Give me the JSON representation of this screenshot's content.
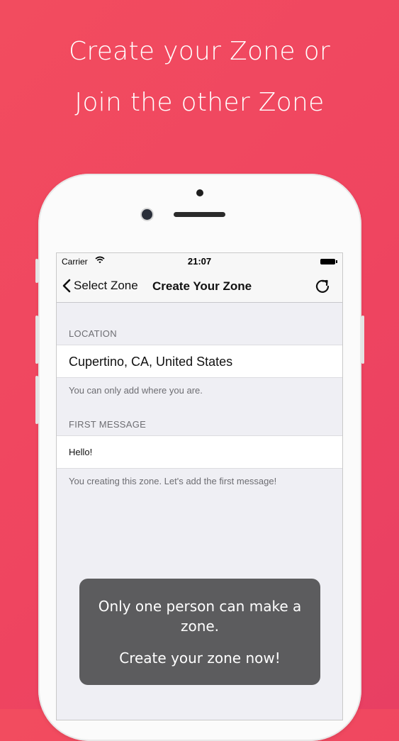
{
  "promo": {
    "line1": "Create your Zone or",
    "line2": "Join the other Zone"
  },
  "status_bar": {
    "carrier": "Carrier",
    "time": "21:07"
  },
  "nav": {
    "back_label": "Select Zone",
    "title": "Create Your Zone"
  },
  "location": {
    "header": "LOCATION",
    "value": "Cupertino, CA, United States",
    "footer": "You can only add where you are."
  },
  "first_message": {
    "header": "FIRST MESSAGE",
    "value": "Hello!",
    "footer": "You creating this zone. Let's add the first message!"
  },
  "toast": {
    "line1": "Only one person can make a zone.",
    "line2": "Create your zone now!"
  },
  "colors": {
    "background": "#ef4560",
    "toast": "#5c5c5e",
    "screen_bg": "#efeff4"
  }
}
